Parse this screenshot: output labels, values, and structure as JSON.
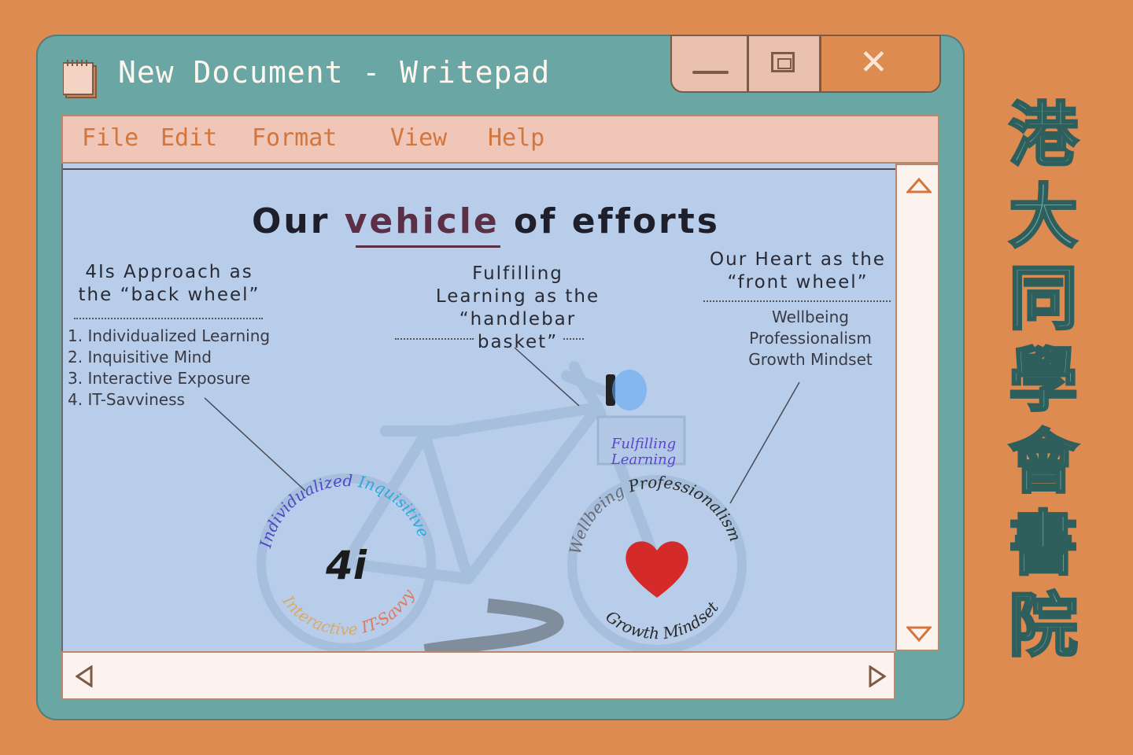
{
  "window": {
    "title": "New Document - Writepad",
    "controls": {
      "minimize": "minimize",
      "maximize": "maximize",
      "close": "close"
    }
  },
  "menu": [
    "File",
    "Edit",
    "Format",
    "View",
    "Help"
  ],
  "slide": {
    "title_pre": "Our ",
    "title_highlight": "vehicle",
    "title_post": " of efforts",
    "back_wheel": {
      "heading_line1": "4Is Approach as",
      "heading_line2": "the “back wheel”",
      "items": [
        "1. Individualized Learning",
        "2. Inquisitive Mind",
        "3. Interactive Exposure",
        "4. IT-Savviness"
      ]
    },
    "handlebar": {
      "line1": "Fulfilling",
      "line2": "Learning as the",
      "line3": "“handlebar",
      "line4": "basket”"
    },
    "front_wheel": {
      "heading_line1": "Our Heart as the",
      "heading_line2": "“front wheel”",
      "values": [
        "Wellbeing",
        "Professionalism",
        "Growth Mindset"
      ]
    },
    "back_wheel_center": "4i",
    "back_wheel_ring": [
      "Individualized",
      "Inquisitive",
      "Interactive",
      "IT-Savvy"
    ],
    "basket_text_line1": "Fulfilling",
    "basket_text_line2": "Learning",
    "front_wheel_ring": [
      "Professionalism",
      "Wellbeing",
      "Growth Mindset"
    ]
  },
  "side_title": "港大同學會書院",
  "colors": {
    "background": "#de8b51",
    "window": "#6aa6a4",
    "menubar": "#efc6b8",
    "menu_text": "#d3763d",
    "content": "#b8cde9",
    "heart": "#d42a2a"
  }
}
